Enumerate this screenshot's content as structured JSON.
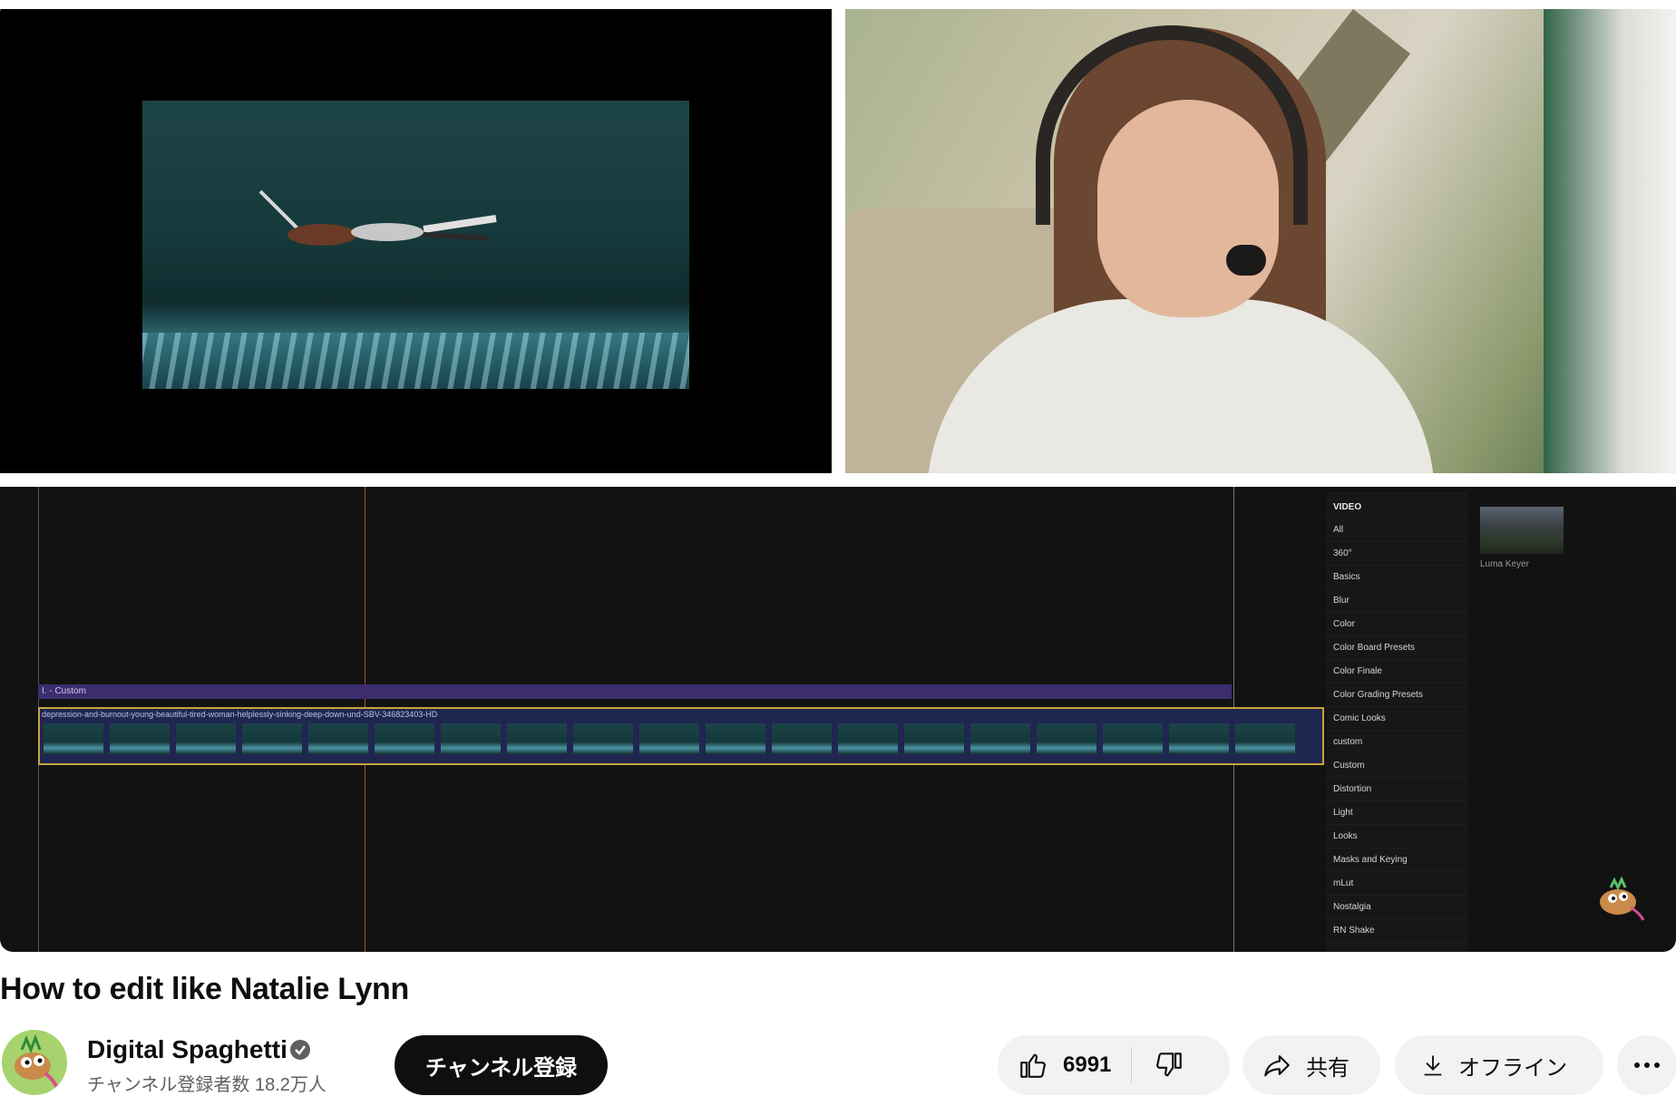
{
  "player": {
    "timeline": {
      "title_bar_label": "I. - Custom",
      "clip_name": "depression-and-burnout-young-beautiful-tired-woman-helplessly-sinking-deep-down-und-SBV-346823403-HD",
      "effects_list": {
        "heading": "VIDEO",
        "items": [
          "All",
          "360°",
          "Basics",
          "Blur",
          "Color",
          "Color Board Presets",
          "Color Finale",
          "Color Grading Presets",
          "Comic Looks",
          "custom",
          "Custom",
          "Distortion",
          "Light",
          "Looks",
          "Masks and Keying",
          "mLut",
          "Nostalgia",
          "RN Shake"
        ]
      },
      "effect_thumbnail_label": "Luma Keyer"
    }
  },
  "video": {
    "title": "How to edit like Natalie Lynn"
  },
  "channel": {
    "name": "Digital Spaghetti",
    "subscribers": "チャンネル登録者数 18.2万人",
    "subscribe_label": "チャンネル登録",
    "verified_icon": "check-circle-icon"
  },
  "actions": {
    "like_count": "6991",
    "share_label": "共有",
    "offline_label": "オフライン",
    "more_icon": "more-horizontal-icon"
  },
  "colors": {
    "timeline_bg": "#121212",
    "title_bar": "#3b2d6e",
    "clip_border": "#c9a33c",
    "subscribe_bg": "#0f0f0f",
    "pill_bg": "#f2f2f2"
  }
}
